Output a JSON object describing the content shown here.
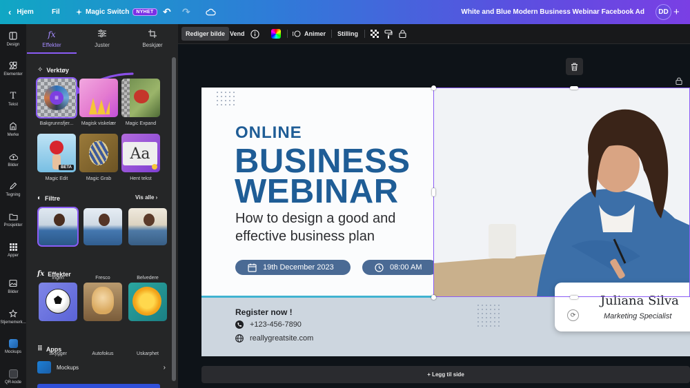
{
  "topbar": {
    "home_label": "Hjem",
    "file_label": "Fil",
    "magic_switch_label": "Magic Switch",
    "new_badge": "NYHET",
    "document_title": "White and Blue Modern Business Webinar Facebook Ad",
    "avatar_initials": "DD"
  },
  "rail": {
    "items": [
      {
        "label": "Design",
        "icon": "layout-icon"
      },
      {
        "label": "Elementer",
        "icon": "shapes-icon"
      },
      {
        "label": "Tekst",
        "icon": "text-icon"
      },
      {
        "label": "Merke",
        "icon": "brand-icon"
      },
      {
        "label": "Bilder",
        "icon": "upload-icon"
      },
      {
        "label": "Tegning",
        "icon": "draw-icon"
      },
      {
        "label": "Prosjekter",
        "icon": "folder-icon"
      },
      {
        "label": "Apper",
        "icon": "apps-icon"
      },
      {
        "label": "Bilder",
        "icon": "photos-icon"
      },
      {
        "label": "Stjernemerk...",
        "icon": "star-icon"
      },
      {
        "label": "Mockups",
        "icon": "mockups-icon"
      },
      {
        "label": "QR-kode",
        "icon": "qr-icon"
      }
    ]
  },
  "panel": {
    "tabs": [
      {
        "label": "Effekter",
        "icon": "fx-icon"
      },
      {
        "label": "Juster",
        "icon": "sliders-icon"
      },
      {
        "label": "Beskjær",
        "icon": "crop-icon"
      }
    ],
    "tools_title": "Verktøy",
    "tools": [
      {
        "label": "Bakgrunnsfjer..."
      },
      {
        "label": "Magisk viskelær"
      },
      {
        "label": "Magic Expand"
      },
      {
        "label": "Magic Edit",
        "badge": "BETA"
      },
      {
        "label": "Magic Grab"
      },
      {
        "label": "Hent tekst"
      }
    ],
    "filters_title": "Filtre",
    "see_all": "Vis alle",
    "filters": [
      {
        "label": "Ingen"
      },
      {
        "label": "Fresco"
      },
      {
        "label": "Belvedere"
      }
    ],
    "effects_title": "Effekter",
    "effects": [
      {
        "label": "Skygger"
      },
      {
        "label": "Autofokus"
      },
      {
        "label": "Uskarphet"
      }
    ],
    "apps_title": "Apps",
    "apps": [
      {
        "label": "Mockups"
      }
    ]
  },
  "toolbar": {
    "edit_image": "Rediger bilde",
    "flip": "Vend",
    "animate": "Animer",
    "position": "Stilling"
  },
  "design": {
    "online": "ONLINE",
    "business": "BUSINESS",
    "webinar": "WEBINAR",
    "subtitle": "How to design a good and effective business plan",
    "date": "19th December 2023",
    "time": "08:00 AM",
    "register": "Register now !",
    "phone": "+123-456-7890",
    "website": "reallygreatsite.com",
    "speaker_name": "Juliana Silva",
    "speaker_role": "Marketing Specialist"
  },
  "add_page_label": "+ Legg til side",
  "colors": {
    "accent": "#8b5cf6",
    "brand_blue": "#1f5d96",
    "pill": "#4a6a94",
    "band": "#cdd6df"
  }
}
